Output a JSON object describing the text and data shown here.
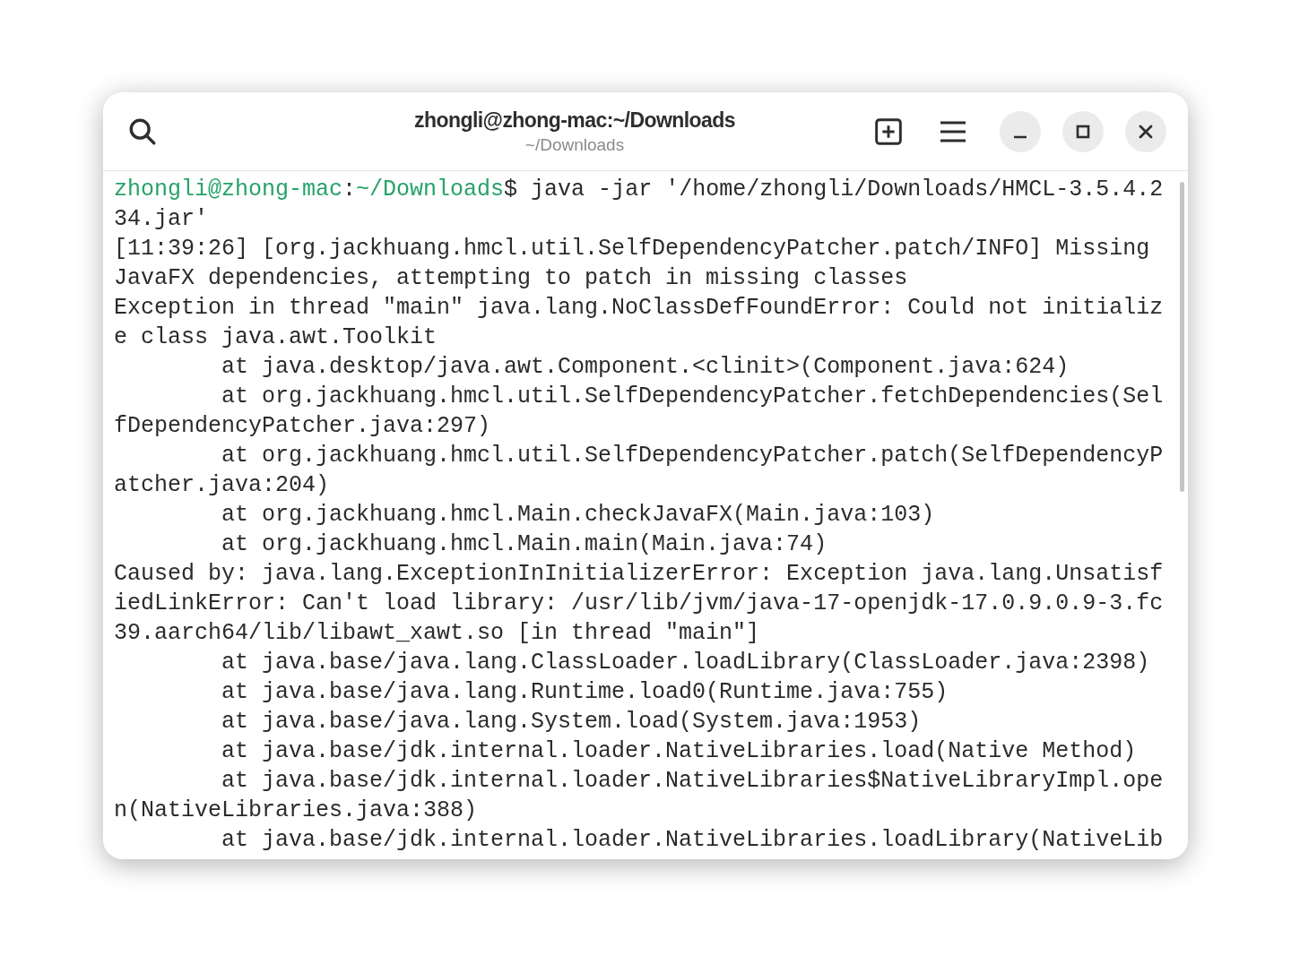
{
  "window": {
    "title": "zhongli@zhong-mac:~/Downloads",
    "subtitle": "~/Downloads"
  },
  "terminal": {
    "prompt": {
      "user_host": "zhongli@zhong-mac",
      "separator": ":",
      "path": "~/Downloads",
      "symbol": "$",
      "command": " java -jar '/home/zhongli/Downloads/HMCL-3.5.4.2"
    },
    "lines": [
      "34.jar'",
      "[11:39:26] [org.jackhuang.hmcl.util.SelfDependencyPatcher.patch/INFO] Missing",
      "JavaFX dependencies, attempting to patch in missing classes",
      "Exception in thread \"main\" java.lang.NoClassDefFoundError: Could not initializ",
      "e class java.awt.Toolkit",
      "        at java.desktop/java.awt.Component.<clinit>(Component.java:624)",
      "        at org.jackhuang.hmcl.util.SelfDependencyPatcher.fetchDependencies(Sel",
      "fDependencyPatcher.java:297)",
      "        at org.jackhuang.hmcl.util.SelfDependencyPatcher.patch(SelfDependencyP",
      "atcher.java:204)",
      "        at org.jackhuang.hmcl.Main.checkJavaFX(Main.java:103)",
      "        at org.jackhuang.hmcl.Main.main(Main.java:74)",
      "Caused by: java.lang.ExceptionInInitializerError: Exception java.lang.Unsatisf",
      "iedLinkError: Can't load library: /usr/lib/jvm/java-17-openjdk-17.0.9.0.9-3.fc",
      "39.aarch64/lib/libawt_xawt.so [in thread \"main\"]",
      "        at java.base/java.lang.ClassLoader.loadLibrary(ClassLoader.java:2398)",
      "        at java.base/java.lang.Runtime.load0(Runtime.java:755)",
      "        at java.base/java.lang.System.load(System.java:1953)",
      "        at java.base/jdk.internal.loader.NativeLibraries.load(Native Method)",
      "        at java.base/jdk.internal.loader.NativeLibraries$NativeLibraryImpl.ope",
      "n(NativeLibraries.java:388)",
      "        at java.base/jdk.internal.loader.NativeLibraries.loadLibrary(NativeLib"
    ]
  }
}
